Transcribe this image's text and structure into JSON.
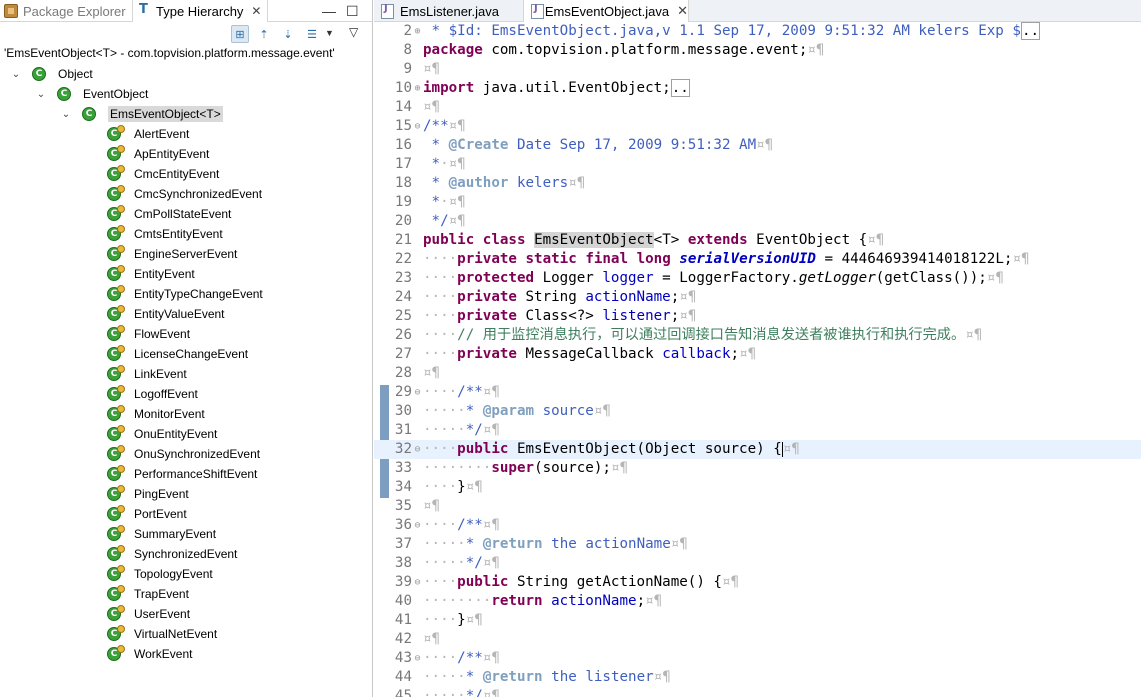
{
  "left_view": {
    "tabs": [
      {
        "label": "Package Explorer",
        "icon": "package-icon",
        "active": false
      },
      {
        "label": "Type Hierarchy",
        "icon": "type-hierarchy-icon",
        "active": true,
        "close": "✕"
      }
    ],
    "view_controls": {
      "minimize": "—",
      "maximize": "☐",
      "menu": "▽"
    },
    "toolbar": [
      {
        "name": "show-type-hierarchy-icon",
        "glyph": "⊞",
        "pressed": true
      },
      {
        "name": "show-supertype-hierarchy-icon",
        "glyph": "⇡",
        "pressed": false
      },
      {
        "name": "show-subtype-hierarchy-icon",
        "glyph": "⇣",
        "pressed": false
      },
      {
        "name": "previous-hierarchies-icon",
        "glyph": "☰",
        "pressed": false
      }
    ],
    "focus_line": "'EmsEventObject<T> - com.topvision.platform.message.event'",
    "tree": [
      {
        "label": "Object",
        "depth": 0,
        "twisty": "open"
      },
      {
        "label": "EventObject",
        "depth": 1,
        "twisty": "open"
      },
      {
        "label": "EmsEventObject<T>",
        "depth": 2,
        "twisty": "open",
        "selected": true
      },
      {
        "label": "AlertEvent",
        "depth": 3
      },
      {
        "label": "ApEntityEvent",
        "depth": 3
      },
      {
        "label": "CmcEntityEvent",
        "depth": 3
      },
      {
        "label": "CmcSynchronizedEvent",
        "depth": 3
      },
      {
        "label": "CmPollStateEvent",
        "depth": 3
      },
      {
        "label": "CmtsEntityEvent",
        "depth": 3
      },
      {
        "label": "EngineServerEvent",
        "depth": 3
      },
      {
        "label": "EntityEvent",
        "depth": 3
      },
      {
        "label": "EntityTypeChangeEvent",
        "depth": 3
      },
      {
        "label": "EntityValueEvent",
        "depth": 3
      },
      {
        "label": "FlowEvent",
        "depth": 3
      },
      {
        "label": "LicenseChangeEvent",
        "depth": 3
      },
      {
        "label": "LinkEvent",
        "depth": 3
      },
      {
        "label": "LogoffEvent",
        "depth": 3
      },
      {
        "label": "MonitorEvent",
        "depth": 3
      },
      {
        "label": "OnuEntityEvent",
        "depth": 3
      },
      {
        "label": "OnuSynchronizedEvent",
        "depth": 3
      },
      {
        "label": "PerformanceShiftEvent",
        "depth": 3
      },
      {
        "label": "PingEvent",
        "depth": 3
      },
      {
        "label": "PortEvent",
        "depth": 3
      },
      {
        "label": "SummaryEvent",
        "depth": 3
      },
      {
        "label": "SynchronizedEvent",
        "depth": 3
      },
      {
        "label": "TopologyEvent",
        "depth": 3
      },
      {
        "label": "TrapEvent",
        "depth": 3
      },
      {
        "label": "UserEvent",
        "depth": 3
      },
      {
        "label": "VirtualNetEvent",
        "depth": 3
      },
      {
        "label": "WorkEvent",
        "depth": 3
      }
    ]
  },
  "editor": {
    "tabs": [
      {
        "label": "EmsListener.java",
        "active": false
      },
      {
        "label": "EmsEventObject.java",
        "active": true,
        "close": "✕"
      }
    ],
    "lines": [
      {
        "n": "2",
        "fold": "⊕",
        "segs": [
          [
            "ws",
            " "
          ],
          [
            "cm",
            "* $Id: "
          ],
          [
            "cm",
            "EmsEventObject.java,v 1.1 "
          ],
          [
            "cm",
            "Sep 17, 2009 9:51:32 AM kelers Exp $"
          ],
          [
            "mk",
            ".."
          ]
        ]
      },
      {
        "n": "8",
        "segs": [
          [
            "kw",
            "package"
          ],
          [
            "",
            " com.topvision.platform.message.event;"
          ],
          [
            "ws",
            "¤¶"
          ]
        ]
      },
      {
        "n": "9",
        "segs": [
          [
            "ws",
            "¤¶"
          ]
        ]
      },
      {
        "n": "10",
        "fold": "⊕",
        "segs": [
          [
            "kw",
            "import"
          ],
          [
            "",
            " java.util.EventObject;"
          ],
          [
            "mk",
            ".."
          ]
        ]
      },
      {
        "n": "14",
        "segs": [
          [
            "ws",
            "¤¶"
          ]
        ]
      },
      {
        "n": "15",
        "fold": "⊖",
        "segs": [
          [
            "cm",
            "/**"
          ],
          [
            "ws",
            "¤¶"
          ]
        ]
      },
      {
        "n": "16",
        "segs": [
          [
            "cm",
            " * "
          ],
          [
            "tag",
            "@Create"
          ],
          [
            "cm",
            " Date Sep 17, 2009 9:51:32 AM"
          ],
          [
            "ws",
            "¤¶"
          ]
        ]
      },
      {
        "n": "17",
        "segs": [
          [
            "cm",
            " *"
          ],
          [
            "ws",
            "·¤¶"
          ]
        ]
      },
      {
        "n": "18",
        "segs": [
          [
            "cm",
            " * "
          ],
          [
            "tag",
            "@author"
          ],
          [
            "cm",
            " kelers"
          ],
          [
            "ws",
            "¤¶"
          ]
        ]
      },
      {
        "n": "19",
        "segs": [
          [
            "cm",
            " *"
          ],
          [
            "ws",
            "·¤¶"
          ]
        ]
      },
      {
        "n": "20",
        "segs": [
          [
            "cm",
            " */"
          ],
          [
            "ws",
            "¤¶"
          ]
        ]
      },
      {
        "n": "21",
        "segs": [
          [
            "kw",
            "public"
          ],
          [
            "",
            " "
          ],
          [
            "kw",
            "class"
          ],
          [
            "",
            " "
          ],
          [
            "hl",
            "EmsEventObject"
          ],
          [
            "",
            "<T> "
          ],
          [
            "kw",
            "extends"
          ],
          [
            "",
            " EventObject {"
          ],
          [
            "ws",
            "¤¶"
          ]
        ]
      },
      {
        "n": "22",
        "segs": [
          [
            "ws",
            "····"
          ],
          [
            "kw",
            "private"
          ],
          [
            "",
            " "
          ],
          [
            "kw",
            "static"
          ],
          [
            "",
            " "
          ],
          [
            "kw",
            "final"
          ],
          [
            "",
            " "
          ],
          [
            "kw",
            "long"
          ],
          [
            "",
            " "
          ],
          [
            "sfld",
            "serialVersionUID"
          ],
          [
            "",
            " = 444646939414018122L;"
          ],
          [
            "ws",
            "¤¶"
          ]
        ]
      },
      {
        "n": "23",
        "segs": [
          [
            "ws",
            "····"
          ],
          [
            "kw",
            "protected"
          ],
          [
            "",
            " Logger "
          ],
          [
            "fld",
            "logger"
          ],
          [
            "",
            " = LoggerFactory."
          ],
          [
            "ital",
            "getLogger"
          ],
          [
            "",
            "(getClass());"
          ],
          [
            "ws",
            "¤¶"
          ]
        ]
      },
      {
        "n": "24",
        "segs": [
          [
            "ws",
            "····"
          ],
          [
            "kw",
            "private"
          ],
          [
            "",
            " String "
          ],
          [
            "fld",
            "actionName"
          ],
          [
            "",
            ";"
          ],
          [
            "ws",
            "¤¶"
          ]
        ]
      },
      {
        "n": "25",
        "segs": [
          [
            "ws",
            "····"
          ],
          [
            "kw",
            "private"
          ],
          [
            "",
            " Class<?> "
          ],
          [
            "fld",
            "listener"
          ],
          [
            "",
            ";"
          ],
          [
            "ws",
            "¤¶"
          ]
        ]
      },
      {
        "n": "26",
        "segs": [
          [
            "ws",
            "····"
          ],
          [
            "lc",
            "// 用于监控消息执行，可以通过回调接口告知消息发送者被谁执行和执行完成。"
          ],
          [
            "ws",
            "¤¶"
          ]
        ]
      },
      {
        "n": "27",
        "segs": [
          [
            "ws",
            "····"
          ],
          [
            "kw",
            "private"
          ],
          [
            "",
            " MessageCallback "
          ],
          [
            "fld",
            "callback"
          ],
          [
            "",
            ";"
          ],
          [
            "ws",
            "¤¶"
          ]
        ]
      },
      {
        "n": "28",
        "segs": [
          [
            "ws",
            "¤¶"
          ]
        ]
      },
      {
        "n": "29",
        "fold": "⊖",
        "segs": [
          [
            "ws",
            "····"
          ],
          [
            "cm",
            "/**"
          ],
          [
            "ws",
            "¤¶"
          ]
        ]
      },
      {
        "n": "30",
        "segs": [
          [
            "ws",
            "·····"
          ],
          [
            "cm",
            "* "
          ],
          [
            "tag",
            "@param"
          ],
          [
            "cm",
            " source"
          ],
          [
            "ws",
            "¤¶"
          ]
        ]
      },
      {
        "n": "31",
        "segs": [
          [
            "ws",
            "·····"
          ],
          [
            "cm",
            "*/"
          ],
          [
            "ws",
            "¤¶"
          ]
        ]
      },
      {
        "n": "32",
        "fold": "⊖",
        "cur": true,
        "segs": [
          [
            "ws",
            "····"
          ],
          [
            "kw",
            "public"
          ],
          [
            "",
            " EmsEventObject(Object source) {"
          ],
          [
            "caret",
            ""
          ],
          [
            "ws",
            "¤¶"
          ]
        ]
      },
      {
        "n": "33",
        "segs": [
          [
            "ws",
            "········"
          ],
          [
            "kw",
            "super"
          ],
          [
            "",
            "(source);"
          ],
          [
            "ws",
            "¤¶"
          ]
        ]
      },
      {
        "n": "34",
        "segs": [
          [
            "ws",
            "····"
          ],
          [
            "",
            "}"
          ],
          [
            "ws",
            "¤¶"
          ]
        ]
      },
      {
        "n": "35",
        "segs": [
          [
            "ws",
            "¤¶"
          ]
        ]
      },
      {
        "n": "36",
        "fold": "⊖",
        "segs": [
          [
            "ws",
            "····"
          ],
          [
            "cm",
            "/**"
          ],
          [
            "ws",
            "¤¶"
          ]
        ]
      },
      {
        "n": "37",
        "segs": [
          [
            "ws",
            "·····"
          ],
          [
            "cm",
            "* "
          ],
          [
            "tag",
            "@return"
          ],
          [
            "cm",
            " the actionName"
          ],
          [
            "ws",
            "¤¶"
          ]
        ]
      },
      {
        "n": "38",
        "segs": [
          [
            "ws",
            "·····"
          ],
          [
            "cm",
            "*/"
          ],
          [
            "ws",
            "¤¶"
          ]
        ]
      },
      {
        "n": "39",
        "fold": "⊖",
        "segs": [
          [
            "ws",
            "····"
          ],
          [
            "kw",
            "public"
          ],
          [
            "",
            " String getActionName() {"
          ],
          [
            "ws",
            "¤¶"
          ]
        ]
      },
      {
        "n": "40",
        "segs": [
          [
            "ws",
            "········"
          ],
          [
            "kw",
            "return"
          ],
          [
            "",
            " "
          ],
          [
            "fld",
            "actionName"
          ],
          [
            "",
            ";"
          ],
          [
            "ws",
            "¤¶"
          ]
        ]
      },
      {
        "n": "41",
        "segs": [
          [
            "ws",
            "····"
          ],
          [
            "",
            "}"
          ],
          [
            "ws",
            "¤¶"
          ]
        ]
      },
      {
        "n": "42",
        "segs": [
          [
            "ws",
            "¤¶"
          ]
        ]
      },
      {
        "n": "43",
        "fold": "⊖",
        "segs": [
          [
            "ws",
            "····"
          ],
          [
            "cm",
            "/**"
          ],
          [
            "ws",
            "¤¶"
          ]
        ]
      },
      {
        "n": "44",
        "segs": [
          [
            "ws",
            "·····"
          ],
          [
            "cm",
            "* "
          ],
          [
            "tag",
            "@return"
          ],
          [
            "cm",
            " the listener"
          ],
          [
            "ws",
            "¤¶"
          ]
        ]
      },
      {
        "n": "45",
        "segs": [
          [
            "ws",
            "·····"
          ],
          [
            "cm",
            "*/"
          ],
          [
            "ws",
            "¤¶"
          ]
        ]
      }
    ]
  }
}
